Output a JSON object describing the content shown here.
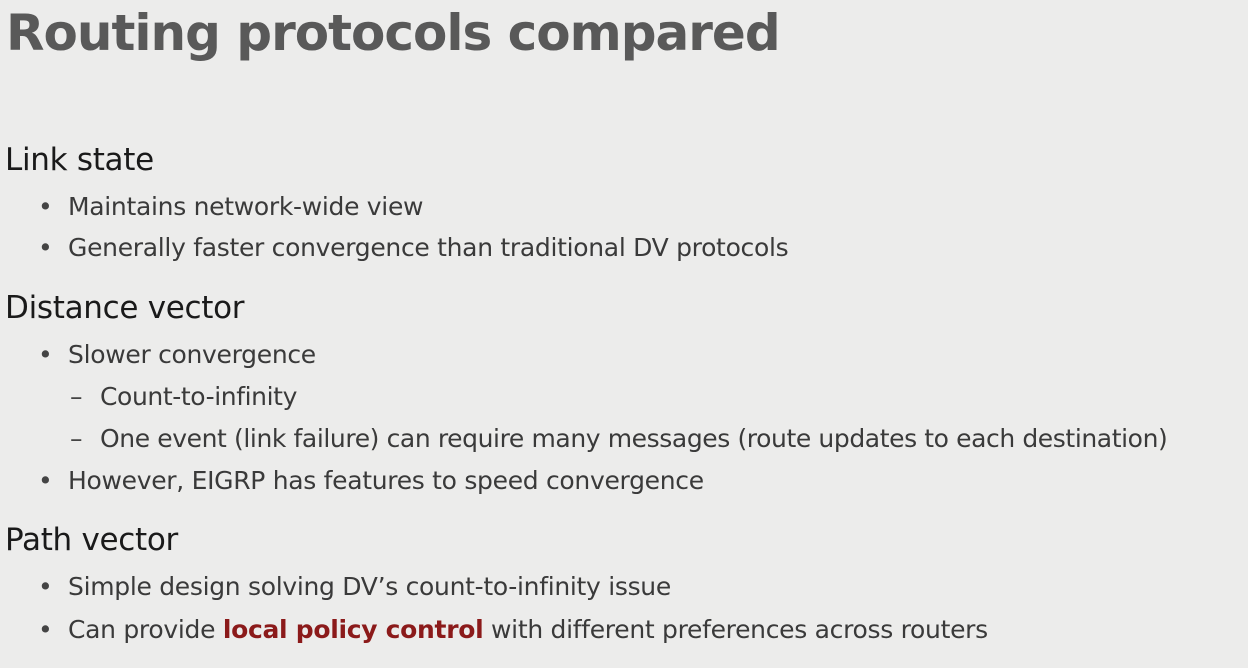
{
  "title": "Routing protocols compared",
  "sections": [
    {
      "heading": "Link state",
      "items": [
        {
          "text": "Maintains network-wide view"
        },
        {
          "text": "Generally faster convergence than traditional DV protocols"
        }
      ]
    },
    {
      "heading": "Distance vector",
      "items": [
        {
          "text": "Slower convergence",
          "subitems": [
            {
              "text": "Count-to-infinity"
            },
            {
              "text": "One event (link failure) can require many messages (route updates to each destination)"
            }
          ]
        },
        {
          "text": "However, EIGRP has features to speed convergence"
        }
      ]
    },
    {
      "heading": "Path vector",
      "items": [
        {
          "text": "Simple design solving DV’s count-to-infinity issue"
        },
        {
          "text_before": "Can provide ",
          "emphasis": "local policy control",
          "text_after": " with different preferences across routers"
        }
      ]
    }
  ],
  "bullet_glyph": "•",
  "dash_glyph": "–",
  "colors": {
    "background": "#ececeb",
    "title": "#595959",
    "emphasis": "#8b1a1a"
  }
}
